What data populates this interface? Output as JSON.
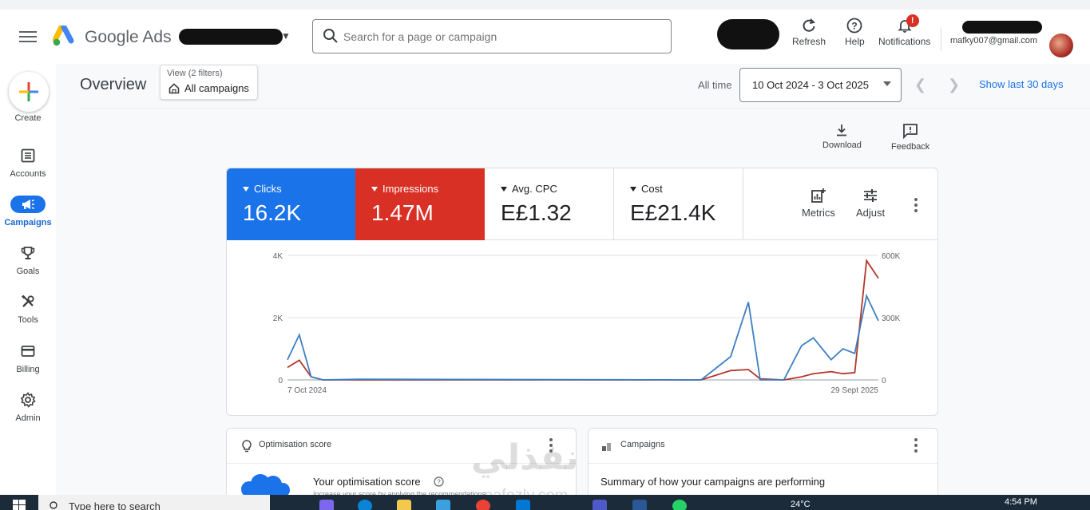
{
  "header": {
    "brand": "Google Ads",
    "search_placeholder": "Search for a page or campaign",
    "refresh_label": "Refresh",
    "help_label": "Help",
    "notifications_label": "Notifications",
    "notifications_badge": "!",
    "email": "mafky007@gmail.com"
  },
  "sidebar": {
    "create_label": "Create",
    "items": [
      {
        "label": "Accounts",
        "icon": "accounts-icon"
      },
      {
        "label": "Campaigns",
        "icon": "megaphone-icon",
        "active": true
      },
      {
        "label": "Goals",
        "icon": "trophy-icon"
      },
      {
        "label": "Tools",
        "icon": "tools-icon"
      },
      {
        "label": "Billing",
        "icon": "card-icon"
      },
      {
        "label": "Admin",
        "icon": "gear-icon"
      }
    ]
  },
  "page": {
    "title": "Overview",
    "view_filters": "View (2 filters)",
    "view_value": "All campaigns",
    "all_time": "All time",
    "date_range": "10 Oct 2024 - 3 Oct 2025",
    "show_last": "Show last 30 days",
    "download_label": "Download",
    "feedback_label": "Feedback"
  },
  "metrics": [
    {
      "label": "Clicks",
      "value": "16.2K",
      "color": "#1a73e8"
    },
    {
      "label": "Impressions",
      "value": "1.47M",
      "color": "#d93025"
    },
    {
      "label": "Avg. CPC",
      "value": "E£1.32"
    },
    {
      "label": "Cost",
      "value": "E£21.4K"
    }
  ],
  "metric_tools": {
    "metrics_label": "Metrics",
    "adjust_label": "Adjust"
  },
  "chart_data": {
    "type": "line",
    "x_start_label": "7 Oct 2024",
    "x_end_label": "29 Sept 2025",
    "y_left_ticks": [
      "4K",
      "2K",
      "0"
    ],
    "y_right_ticks": [
      "600K",
      "300K",
      "0"
    ],
    "ylim_left": [
      0,
      4000
    ],
    "ylim_right": [
      0,
      600000
    ],
    "grid": true,
    "series": [
      {
        "name": "Clicks",
        "axis": "left",
        "color": "#3d7fc1",
        "values": [
          650,
          1450,
          100,
          0,
          0,
          0,
          20,
          0,
          0,
          0,
          0,
          0,
          0,
          0,
          0,
          0,
          0,
          0,
          0,
          0,
          0,
          0,
          0,
          0,
          0,
          0,
          0,
          0,
          0,
          0,
          0,
          0,
          0,
          0,
          0,
          0,
          0,
          0,
          0,
          0,
          0,
          0,
          0,
          0,
          0,
          0,
          0,
          0,
          0,
          0,
          0,
          0,
          0,
          0,
          0,
          0,
          0,
          0,
          0,
          0,
          0,
          0,
          0,
          0,
          0,
          0,
          0,
          0,
          0,
          0,
          0,
          0,
          0,
          0,
          0,
          0,
          0,
          0,
          0,
          0,
          0,
          0,
          0,
          0,
          0,
          0,
          0,
          0,
          0,
          0,
          0,
          0,
          0,
          0,
          0,
          0,
          0,
          0,
          0,
          0,
          0,
          0,
          0,
          0,
          0,
          0,
          0,
          0,
          0,
          0,
          0,
          0,
          0,
          0,
          0,
          0,
          0,
          0,
          0,
          0,
          0,
          0,
          0,
          0,
          0,
          0,
          0,
          0,
          0,
          0,
          0,
          0,
          0,
          0,
          0,
          0,
          0,
          0,
          0,
          0,
          0,
          0,
          0,
          0,
          0,
          0,
          0,
          0,
          0,
          0,
          0,
          0,
          0,
          0,
          0,
          0,
          0,
          0,
          0,
          0,
          0,
          0,
          0,
          0,
          0,
          0,
          0,
          0,
          0,
          0,
          0,
          0,
          0,
          0,
          0,
          0,
          0,
          0,
          0,
          0,
          0,
          0,
          0,
          0,
          0,
          0,
          0,
          0,
          0,
          0,
          0,
          0,
          0,
          0,
          0,
          0,
          0,
          0,
          0,
          0,
          0,
          0,
          0,
          0,
          0,
          0,
          0,
          0,
          0,
          0,
          0,
          0,
          0,
          0,
          0,
          0,
          0,
          0,
          0,
          0,
          0,
          0,
          0,
          0,
          0,
          0,
          0,
          0,
          0,
          0,
          0,
          0,
          0,
          0,
          0,
          0,
          0,
          0,
          0,
          0,
          0,
          0,
          0,
          0,
          0,
          0,
          0,
          0,
          0,
          0,
          0,
          0,
          0,
          0,
          0,
          0,
          0,
          0,
          0,
          0,
          0,
          0,
          0,
          0,
          0,
          0,
          0,
          0,
          0,
          0,
          0,
          0,
          0,
          0,
          0,
          0,
          0,
          0,
          0,
          0,
          0,
          0,
          0,
          0,
          0,
          0,
          0,
          0,
          0,
          0,
          0,
          0,
          0,
          0,
          0,
          0,
          0,
          0,
          0,
          0,
          0,
          0,
          0,
          0,
          0,
          0,
          0,
          0,
          0,
          0,
          0,
          0,
          0,
          0,
          0,
          0,
          0,
          0,
          0,
          0,
          0,
          0,
          0,
          0,
          0,
          0,
          0,
          0,
          0,
          0,
          0,
          0,
          0,
          0,
          0,
          0,
          0,
          0,
          0,
          0,
          0,
          0,
          0,
          0,
          0,
          0,
          0,
          0,
          0,
          0,
          0,
          0,
          0,
          0,
          0,
          0,
          0,
          0,
          0,
          0,
          0,
          0,
          0,
          0
        ]
      }
    ]
  },
  "chart_points": {
    "clicks": [
      [
        0,
        650
      ],
      [
        2,
        1450
      ],
      [
        4,
        100
      ],
      [
        6,
        0
      ],
      [
        12,
        20
      ],
      [
        70,
        0
      ],
      [
        75,
        750
      ],
      [
        78,
        2500
      ],
      [
        80,
        0
      ],
      [
        84,
        0
      ],
      [
        87,
        1100
      ],
      [
        89,
        1350
      ],
      [
        92,
        650
      ],
      [
        94,
        1000
      ],
      [
        96,
        850
      ],
      [
        98,
        2700
      ],
      [
        100,
        1900
      ]
    ],
    "impressions": [
      [
        0,
        60000
      ],
      [
        2,
        95000
      ],
      [
        4,
        15000
      ],
      [
        6,
        0
      ],
      [
        70,
        0
      ],
      [
        75,
        45000
      ],
      [
        78,
        50000
      ],
      [
        80,
        5000
      ],
      [
        84,
        0
      ],
      [
        87,
        15000
      ],
      [
        89,
        30000
      ],
      [
        92,
        40000
      ],
      [
        94,
        30000
      ],
      [
        96,
        35000
      ],
      [
        98,
        575000
      ],
      [
        100,
        490000
      ]
    ]
  },
  "cards": {
    "optimisation_title": "Optimisation score",
    "optimisation_heading": "Your optimisation score",
    "optimisation_sub": "Increase your score by applying the recommendations",
    "campaigns_title": "Campaigns",
    "campaigns_heading": "Summary of how your campaigns are performing"
  },
  "taskbar": {
    "search_placeholder": "Type here to search",
    "temperature": "24°C",
    "time": "4:54 PM"
  },
  "watermark": {
    "arabic": "نفذلي",
    "latin": "nafezly.com"
  }
}
